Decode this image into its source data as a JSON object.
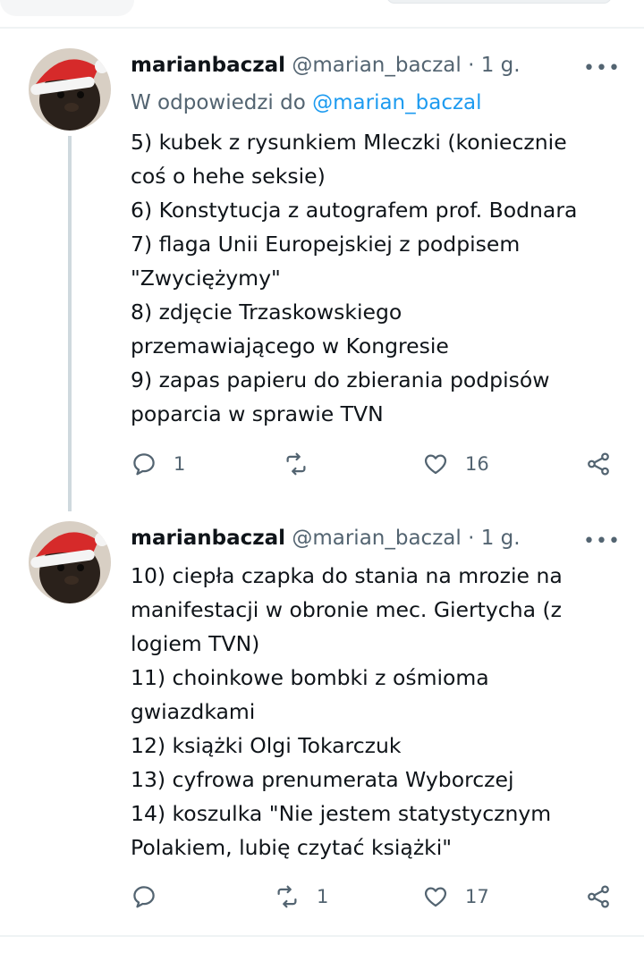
{
  "tweets": [
    {
      "display_name": "marianbaczal",
      "handle": "@marian_baczal",
      "separator": "·",
      "time": "1 g.",
      "more": "•••",
      "reply_prefix": "W odpowiedzi do",
      "reply_mention": "@marian_baczal",
      "lines": [
        "5) kubek z rysunkiem Mleczki (koniecznie",
        "coś o hehe seksie)",
        "6) Konstytucja z autografem prof. Bodnara",
        "7) flaga Unii Europejskiej z  podpisem",
        "\"Zwyciężymy\"",
        "8) zdjęcie Trzaskowskiego",
        "przemawiającego w Kongresie",
        "9) zapas papieru do zbierania podpisów",
        "poparcia w sprawie TVN"
      ],
      "reply_count": "1",
      "retweet_count": "",
      "like_count": "16"
    },
    {
      "display_name": "marianbaczal",
      "handle": "@marian_baczal",
      "separator": "·",
      "time": "1 g.",
      "more": "•••",
      "lines": [
        "10) ciepła czapka do stania na mrozie na",
        "manifestacji w obronie mec. Giertycha (z",
        "logiem TVN)",
        "11) choinkowe bombki z ośmioma",
        "gwiazdkami",
        "12) książki Olgi Tokarczuk",
        "13) cyfrowa prenumerata Wyborczej",
        "14) koszulka \"Nie jestem statystycznym",
        "Polakiem, lubię czytać książki\""
      ],
      "reply_count": "",
      "retweet_count": "1",
      "like_count": "17"
    }
  ],
  "icons": {
    "reply": "reply-icon",
    "retweet": "retweet-icon",
    "like": "heart-icon",
    "share": "share-icon",
    "more": "more-icon"
  },
  "colors": {
    "accent": "#1d9bf0",
    "muted": "#536471",
    "text": "#0f1419",
    "thread_line": "#cfd9de",
    "santa_hat": "#d62a2a"
  }
}
